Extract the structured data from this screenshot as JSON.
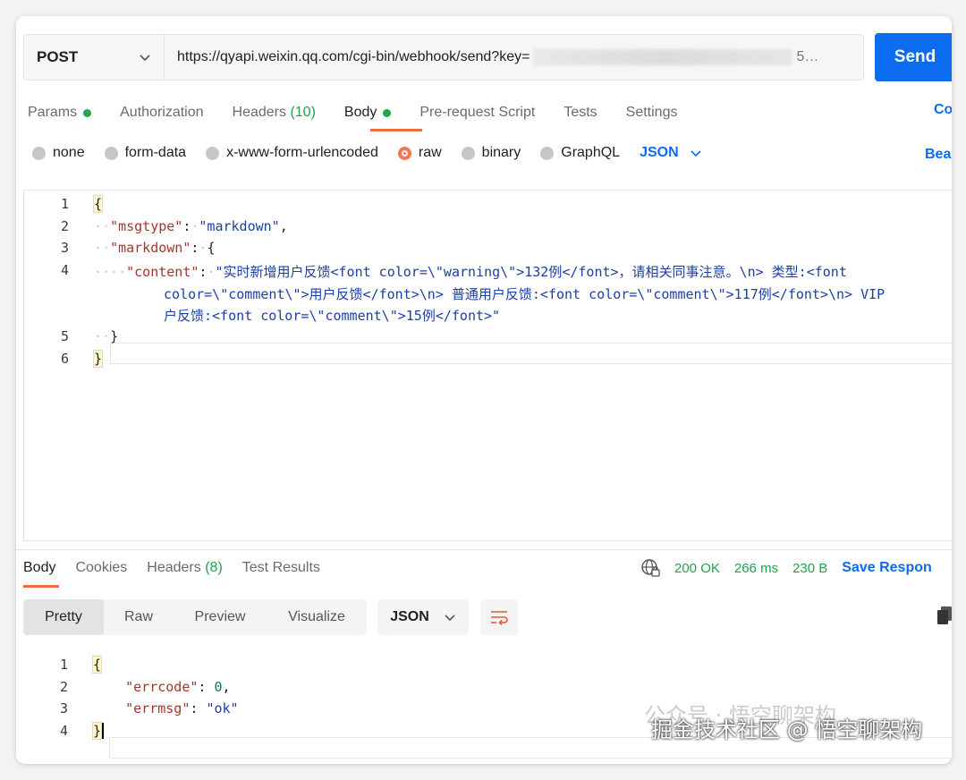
{
  "request": {
    "method": "POST",
    "url": "https://qyapi.weixin.qq.com/cgi-bin/webhook/send?key=",
    "url_tail": "5…",
    "send_label": "Send"
  },
  "tabs": [
    {
      "label": "Params"
    },
    {
      "label": "Authorization"
    },
    {
      "label": "Headers",
      "count": "(10)"
    },
    {
      "label": "Body"
    },
    {
      "label": "Pre-request Script"
    },
    {
      "label": "Tests"
    },
    {
      "label": "Settings"
    }
  ],
  "cookies_link": "Co",
  "body_types": [
    "none",
    "form-data",
    "x-www-form-urlencoded",
    "raw",
    "binary",
    "GraphQL"
  ],
  "body_format": "JSON",
  "beautify_link": "Bea",
  "request_body": {
    "line_numbers": [
      "1",
      "2",
      "3",
      "4",
      "5",
      "6"
    ],
    "open_brace": "{",
    "close_brace": "}",
    "key_msgtype": "\"msgtype\"",
    "val_msgtype": "\"markdown\"",
    "key_markdown": "\"markdown\"",
    "key_content": "\"content\"",
    "content_line1": "\"实时新增用户反馈<font color=\\\"warning\\\">132例</font>，请相关同事注意。\\n> 类型:<font",
    "content_line2": "color=\\\"comment\\\">用户反馈</font>\\n> 普通用户反馈:<font color=\\\"comment\\\">117例</font>\\n> VIP",
    "content_line3": "户反馈:<font color=\\\"comment\\\">15例</font>\""
  },
  "response": {
    "tabs": [
      {
        "label": "Body"
      },
      {
        "label": "Cookies"
      },
      {
        "label": "Headers",
        "count": "(8)"
      },
      {
        "label": "Test Results"
      }
    ],
    "status": "200 OK",
    "time": "266 ms",
    "size": "230 B",
    "save_label": "Save Respon",
    "view_modes": [
      "Pretty",
      "Raw",
      "Preview",
      "Visualize"
    ],
    "format": "JSON",
    "line_numbers": [
      "1",
      "2",
      "3",
      "4"
    ],
    "key_errcode": "\"errcode\"",
    "val_errcode": "0",
    "key_errmsg": "\"errmsg\"",
    "val_errmsg": "\"ok\""
  },
  "watermark": "掘金技术社区 @ 悟空聊架构",
  "watermark_ghost": "公众号 · 悟空聊架构",
  "colors": {
    "accent": "#f26b3a",
    "send": "#0b6cf0",
    "success": "#21a14a",
    "json_key": "#a5352f",
    "json_string": "#1c3fa6"
  }
}
